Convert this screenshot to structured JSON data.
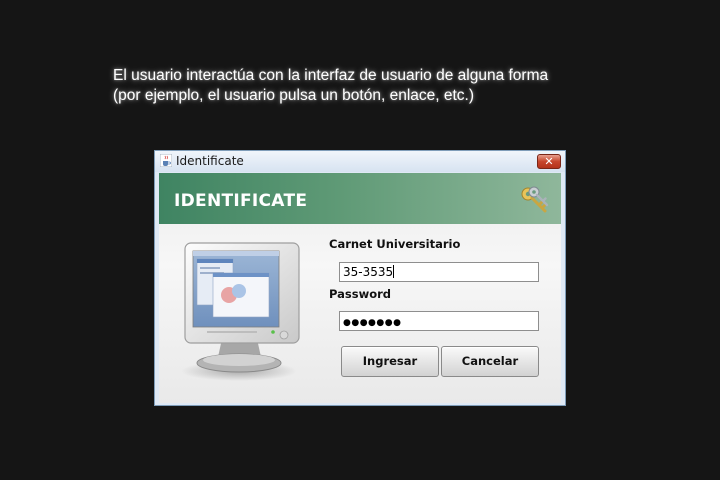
{
  "caption": {
    "line1": "El usuario interactúa con la interfaz de usuario de alguna forma",
    "line2": "(por ejemplo, el usuario pulsa un botón, enlace, etc.)"
  },
  "window": {
    "title": "Identificate",
    "close_label": "✕"
  },
  "banner": {
    "title": "IDENTIFICATE"
  },
  "form": {
    "carnet_label": "Carnet Universitario",
    "carnet_value": "35-3535",
    "password_label": "Password",
    "password_mask": "●●●●●●●",
    "ingresar_label": "Ingresar",
    "cancelar_label": "Cancelar"
  },
  "icons": {
    "title_icon": "java-cup-icon",
    "banner_icon": "keys-icon",
    "illustration": "computer-monitor-icon",
    "close": "close-icon"
  },
  "colors": {
    "background": "#151515",
    "banner_start": "#3f8462",
    "banner_end": "#8fb79b",
    "close_button": "#c7462c"
  }
}
